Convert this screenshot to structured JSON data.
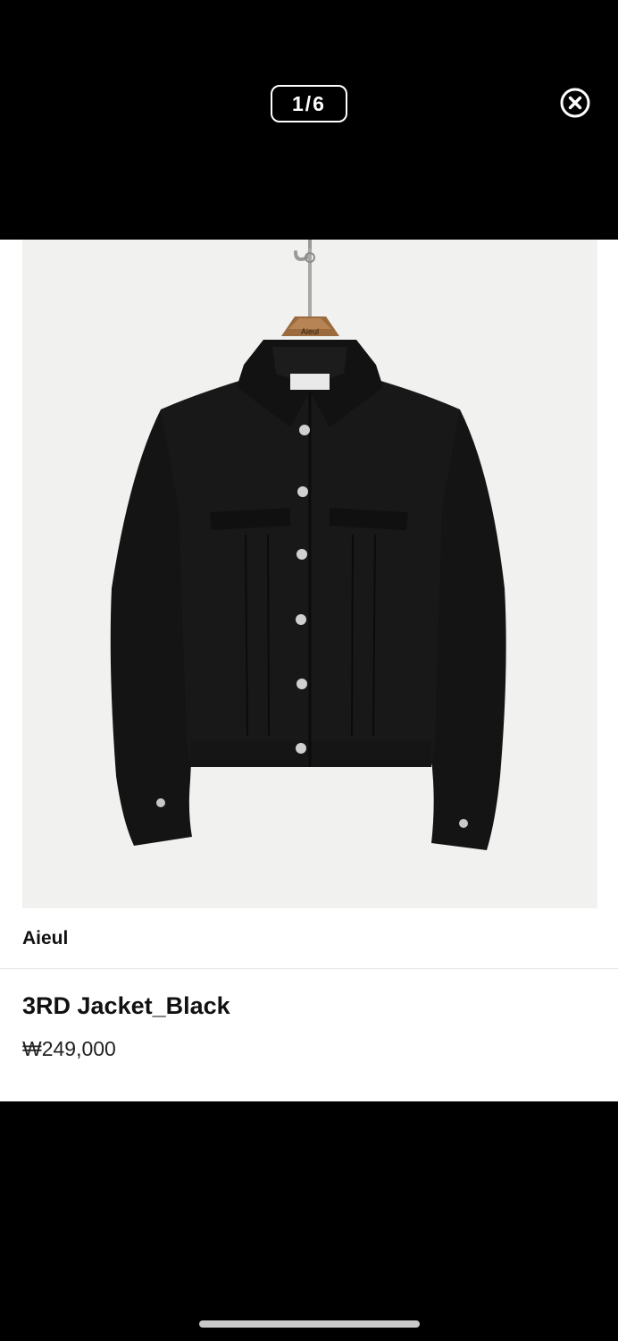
{
  "viewer": {
    "counter": "1/6",
    "close_icon": "close-circle-icon"
  },
  "product": {
    "image_alt": "black denim jacket on wooden hanger",
    "hanger_label": "Aieul",
    "brand": "Aieul",
    "title": "3RD Jacket_Black",
    "price": "₩249,000"
  },
  "colors": {
    "backdrop": "#000000",
    "card": "#ffffff",
    "image_bg": "#f1f1f0",
    "divider": "#e3e3e3"
  }
}
